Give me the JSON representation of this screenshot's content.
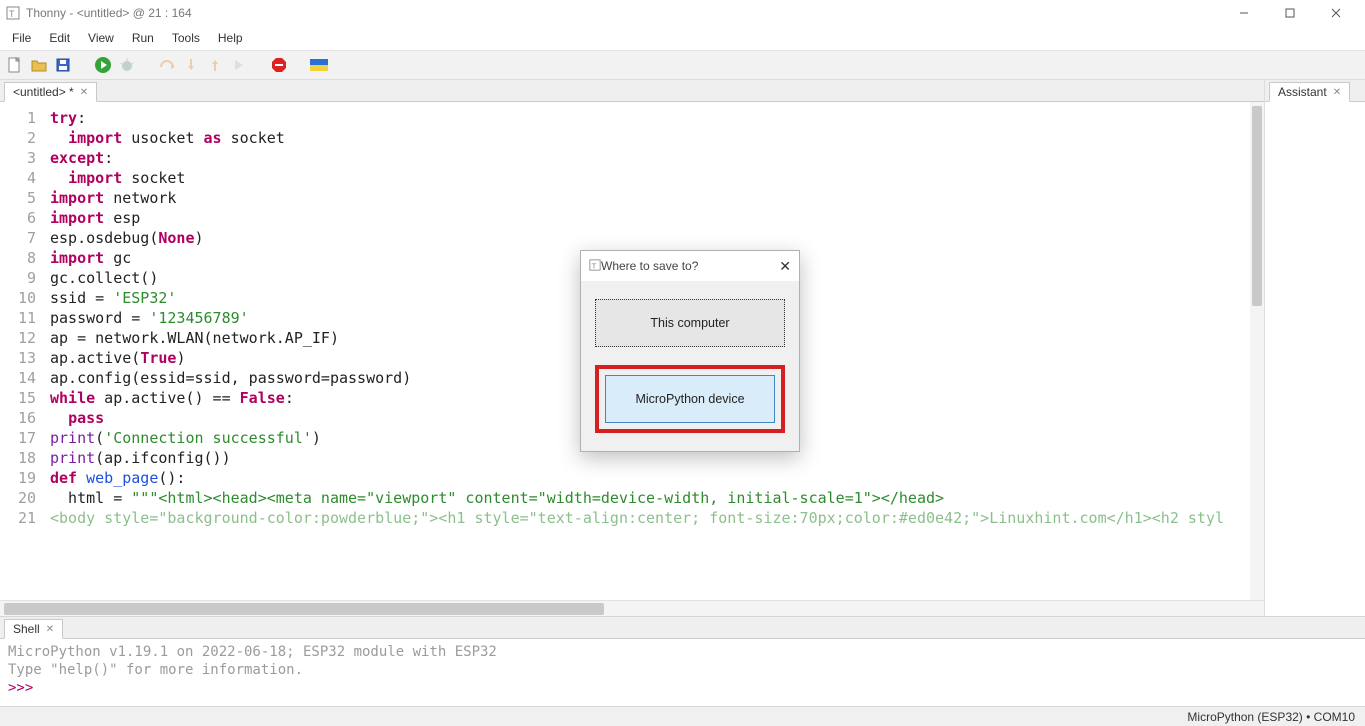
{
  "window": {
    "title": "Thonny  -  <untitled>  @  21 : 164",
    "min_icon": "−",
    "max_icon": "▢",
    "close_icon": "✕"
  },
  "menu": {
    "file": "File",
    "edit": "Edit",
    "view": "View",
    "run": "Run",
    "tools": "Tools",
    "help": "Help"
  },
  "tabs": {
    "editor": "<untitled> *",
    "assistant": "Assistant",
    "shell": "Shell"
  },
  "code_lines": [
    {
      "n": 1,
      "html": "<span class='kw'>try</span>:"
    },
    {
      "n": 2,
      "html": "  <span class='kw'>import</span> usocket <span class='kw'>as</span> socket"
    },
    {
      "n": 3,
      "html": "<span class='kw'>except</span>:"
    },
    {
      "n": 4,
      "html": "  <span class='kw'>import</span> socket"
    },
    {
      "n": 5,
      "html": "<span class='kw'>import</span> network"
    },
    {
      "n": 6,
      "html": "<span class='kw'>import</span> esp"
    },
    {
      "n": 7,
      "html": "esp.osdebug(<span class='kw'>None</span>)"
    },
    {
      "n": 8,
      "html": "<span class='kw'>import</span> gc"
    },
    {
      "n": 9,
      "html": "gc.collect()"
    },
    {
      "n": 10,
      "html": "ssid = <span class='str'>'ESP32'</span>"
    },
    {
      "n": 11,
      "html": "password = <span class='str'>'123456789'</span>"
    },
    {
      "n": 12,
      "html": "ap = network.WLAN(network.AP_IF)"
    },
    {
      "n": 13,
      "html": "ap.active(<span class='kw'>True</span>)"
    },
    {
      "n": 14,
      "html": "ap.config(essid=ssid, password=password)"
    },
    {
      "n": 15,
      "html": "<span class='kw'>while</span> ap.active() == <span class='kw'>False</span>:"
    },
    {
      "n": 16,
      "html": "  <span class='kw'>pass</span>"
    },
    {
      "n": 17,
      "html": "<span class='bt'>print</span>(<span class='str'>'Connection successful'</span>)"
    },
    {
      "n": 18,
      "html": "<span class='bt'>print</span>(ap.ifconfig())"
    },
    {
      "n": 19,
      "html": "<span class='kw'>def</span> <span class='fn'>web_page</span>():"
    },
    {
      "n": 20,
      "html": "  html = <span class='str'>\"\"\"&lt;html&gt;&lt;head&gt;&lt;meta name=\"viewport\" content=\"width=device-width, initial-scale=1\"&gt;&lt;/head&gt;</span>"
    },
    {
      "n": 21,
      "html": "<span class='str faded'>&lt;body style=\"background-color:powderblue;\"&gt;&lt;h1 style=\"text-align:center; font-size:70px;color:#ed0e42;\"&gt;Linuxhint.com&lt;/h1&gt;&lt;h2 styl</span>"
    }
  ],
  "shell": {
    "line1": "MicroPython v1.19.1 on 2022-06-18; ESP32 module with ESP32",
    "line2": "Type \"help()\" for more information.",
    "prompt": ">>> "
  },
  "status": "MicroPython (ESP32)  •  COM10",
  "dialog": {
    "title": "Where to save to?",
    "opt1": "This computer",
    "opt2": "MicroPython device"
  }
}
